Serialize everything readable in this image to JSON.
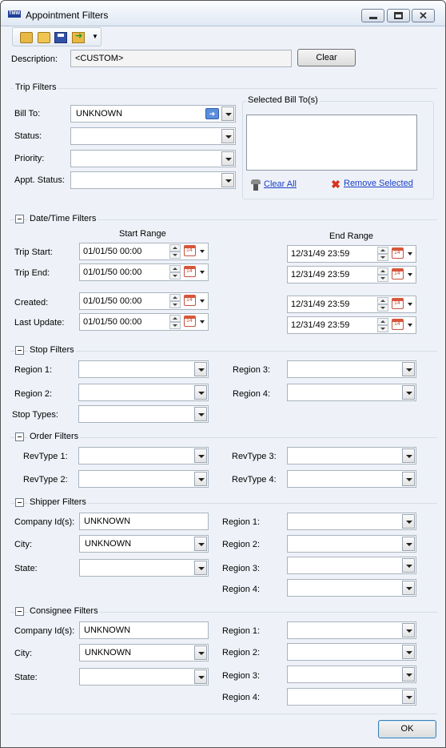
{
  "window": {
    "title": "Appointment Filters",
    "app_icon_text": "TMW"
  },
  "description": {
    "label": "Description:",
    "value": "<CUSTOM>",
    "clear_button": "Clear"
  },
  "trip_filters": {
    "title": "Trip Filters",
    "bill_to": {
      "label": "Bill To:",
      "value": "UNKNOWN"
    },
    "status": {
      "label": "Status:",
      "value": ""
    },
    "priority": {
      "label": "Priority:",
      "value": ""
    },
    "appt_status": {
      "label": "Appt. Status:",
      "value": ""
    },
    "selected_bill_to": {
      "title": "Selected Bill To(s)",
      "items": [],
      "clear_all": "Clear All",
      "remove_selected": "Remove Selected"
    }
  },
  "datetime_filters": {
    "title": "Date/Time Filters",
    "start_range_header": "Start Range",
    "end_range_header": "End Range",
    "rows": [
      {
        "label": "Trip Start:",
        "start": "01/01/50 00:00",
        "end": "12/31/49 23:59"
      },
      {
        "label": "Trip End:",
        "start": "01/01/50 00:00",
        "end": "12/31/49 23:59"
      },
      {
        "label": "Created:",
        "start": "01/01/50 00:00",
        "end": "12/31/49 23:59"
      },
      {
        "label": "Last Update:",
        "start": "01/01/50 00:00",
        "end": "12/31/49 23:59"
      }
    ]
  },
  "stop_filters": {
    "title": "Stop Filters",
    "region1": "Region 1:",
    "region2": "Region 2:",
    "region3": "Region 3:",
    "region4": "Region 4:",
    "stop_types": "Stop Types:"
  },
  "order_filters": {
    "title": "Order Filters",
    "revtype1": "RevType 1:",
    "revtype2": "RevType 2:",
    "revtype3": "RevType 3:",
    "revtype4": "RevType 4:"
  },
  "shipper_filters": {
    "title": "Shipper Filters",
    "company_label": "Company Id(s):",
    "company_value": "UNKNOWN",
    "city_label": "City:",
    "city_value": "UNKNOWN",
    "state_label": "State:",
    "region1": "Region 1:",
    "region2": "Region 2:",
    "region3": "Region 3:",
    "region4": "Region 4:"
  },
  "consignee_filters": {
    "title": "Consignee Filters",
    "company_label": "Company Id(s):",
    "company_value": "UNKNOWN",
    "city_label": "City:",
    "city_value": "UNKNOWN",
    "state_label": "State:",
    "region1": "Region 1:",
    "region2": "Region 2:",
    "region3": "Region 3:",
    "region4": "Region 4:"
  },
  "ok_button": "OK"
}
